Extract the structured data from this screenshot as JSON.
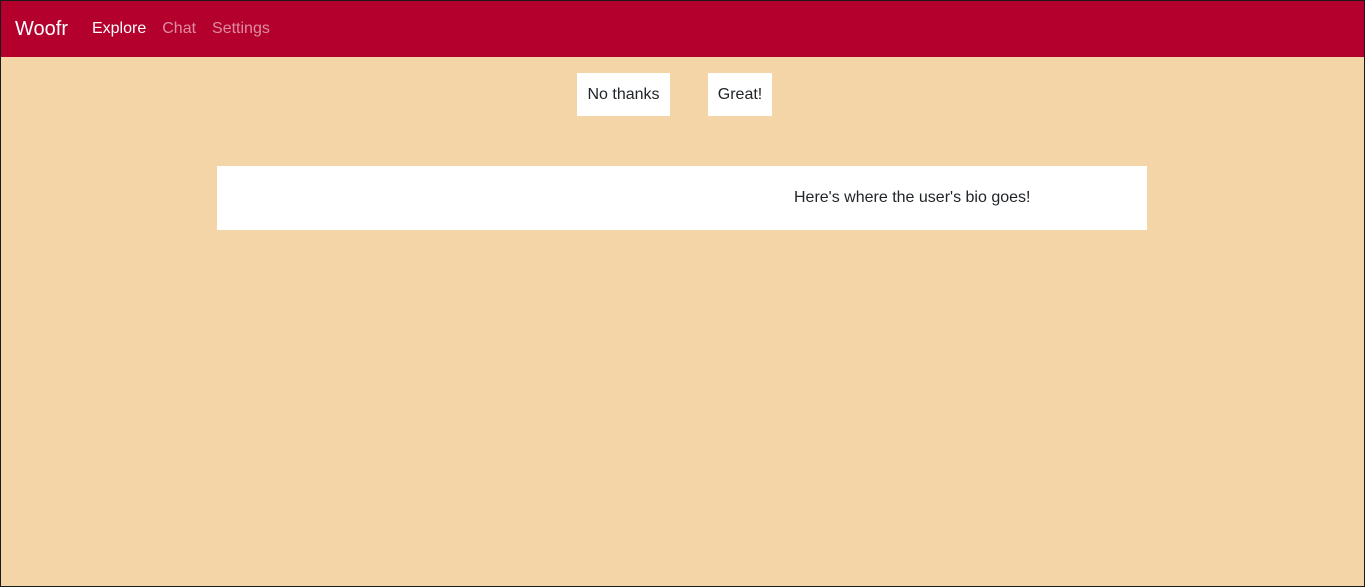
{
  "navbar": {
    "brand": "Woofr",
    "links": [
      {
        "label": "Explore",
        "active": true
      },
      {
        "label": "Chat",
        "active": false
      },
      {
        "label": "Settings",
        "active": false
      }
    ],
    "color": "#b3002d"
  },
  "actions": {
    "reject_label": "No thanks",
    "accept_label": "Great!"
  },
  "profile": {
    "bio": "Here's where the user's bio goes!"
  },
  "theme": {
    "background": "#f3d5a8"
  }
}
